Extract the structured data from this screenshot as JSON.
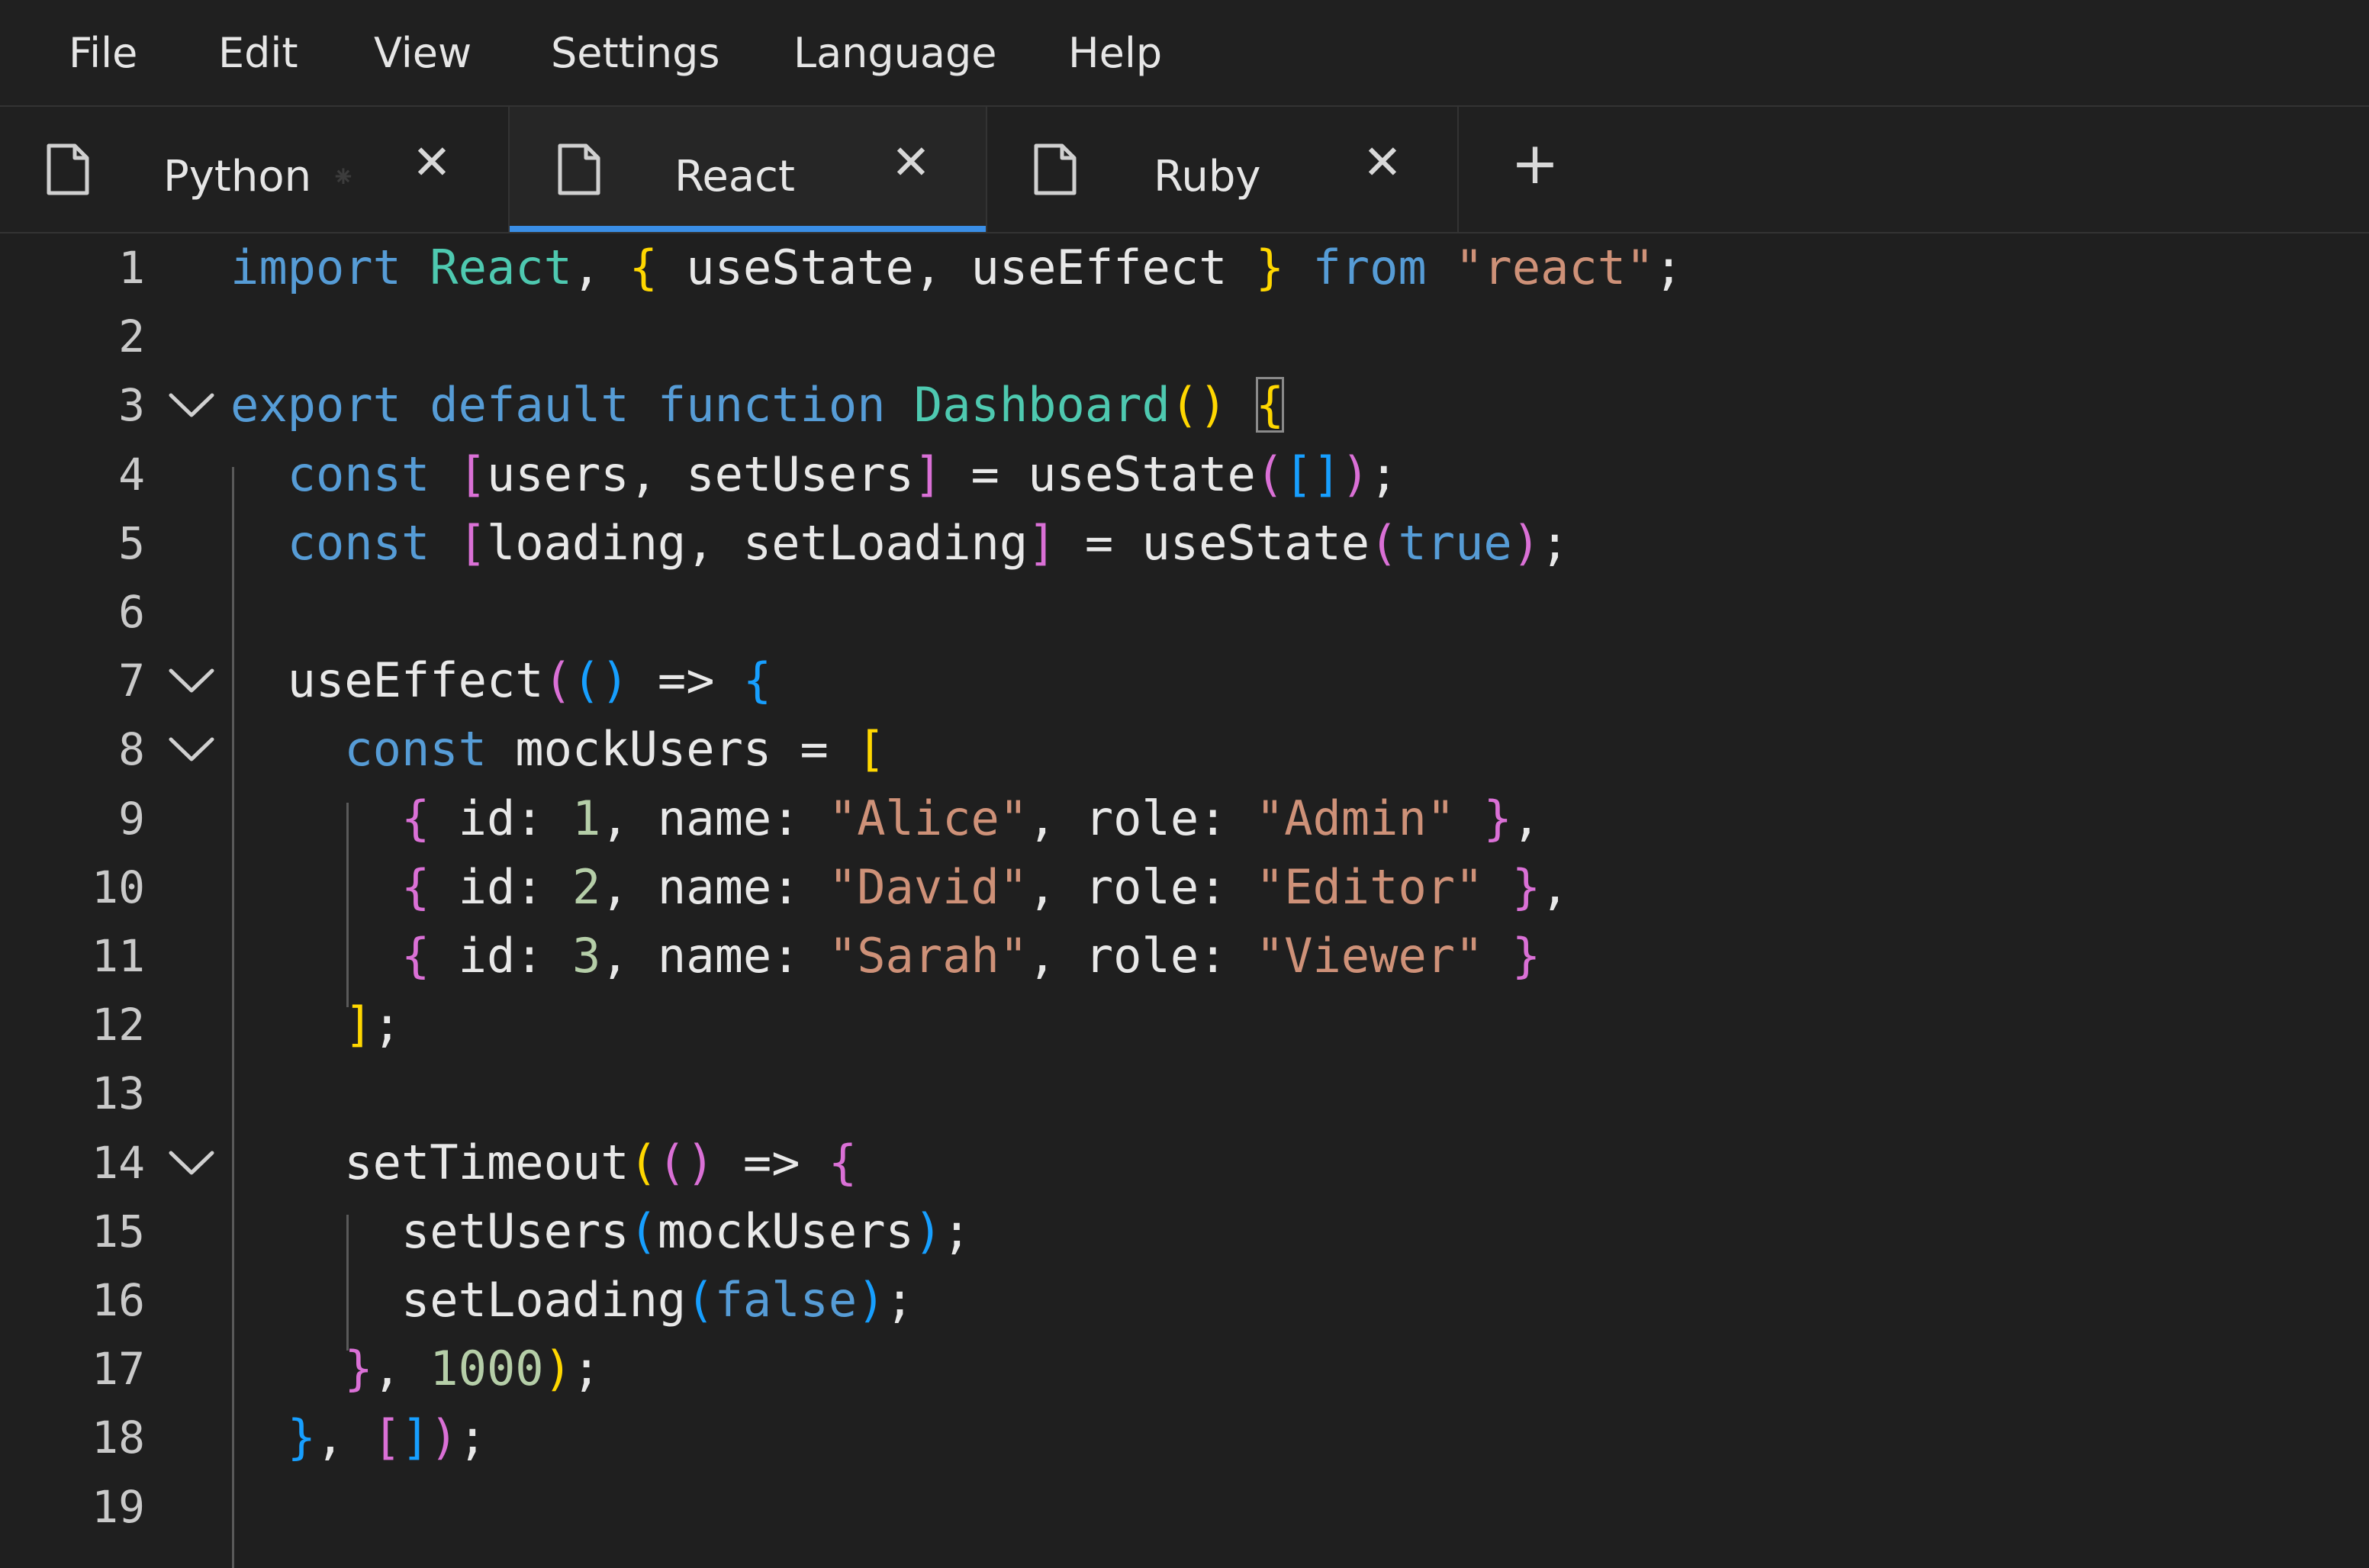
{
  "menu": {
    "items": [
      "File",
      "Edit",
      "View",
      "Settings",
      "Language",
      "Help"
    ]
  },
  "tabs": [
    {
      "label": "Python",
      "icon": "file-icon",
      "active": false,
      "dirty_marker": "⁕"
    },
    {
      "label": "React",
      "icon": "file-icon",
      "active": true
    },
    {
      "label": "Ruby",
      "icon": "file-icon",
      "active": false
    }
  ],
  "tab_close_glyph": "✕",
  "new_tab_glyph": "+",
  "colors": {
    "keyword": "#569cd6",
    "type": "#4ec9b0",
    "string": "#ce9178",
    "number": "#b5cea8",
    "bracket_level1": "#ffd700",
    "bracket_level2": "#da70d6",
    "bracket_level3": "#179fff",
    "active_tab_indicator": "#3a8ee6"
  },
  "editor": {
    "language": "React",
    "lines": [
      {
        "n": "1",
        "fold": false,
        "tokens": [
          [
            "kw",
            "import"
          ],
          [
            "",
            "␠"
          ],
          [
            "ty",
            "React"
          ],
          [
            "",
            ", "
          ],
          [
            "b1",
            "{"
          ],
          [
            "",
            " useState, useEffect "
          ],
          [
            "b1",
            "}"
          ],
          [
            "",
            " "
          ],
          [
            "kw",
            "from"
          ],
          [
            "",
            " "
          ],
          [
            "str",
            "\"react\""
          ],
          [
            "",
            ";"
          ]
        ]
      },
      {
        "n": "2",
        "fold": false,
        "tokens": []
      },
      {
        "n": "3",
        "fold": true,
        "tokens": [
          [
            "kw",
            "export"
          ],
          [
            "",
            " "
          ],
          [
            "kw",
            "default"
          ],
          [
            "",
            " "
          ],
          [
            "kw",
            "function"
          ],
          [
            "",
            " "
          ],
          [
            "ty",
            "Dashboard"
          ],
          [
            "b1",
            "()"
          ],
          [
            "",
            " "
          ],
          [
            "b1m",
            "{"
          ]
        ]
      },
      {
        "n": "4",
        "fold": false,
        "tokens": [
          [
            "",
            "  "
          ],
          [
            "kw",
            "const"
          ],
          [
            "",
            " "
          ],
          [
            "b2",
            "["
          ],
          [
            "",
            "users, setUsers"
          ],
          [
            "b2",
            "]"
          ],
          [
            "",
            " = useState"
          ],
          [
            "b2",
            "("
          ],
          [
            "b3",
            "[]"
          ],
          [
            "b2",
            ")"
          ],
          [
            "",
            ";"
          ]
        ]
      },
      {
        "n": "5",
        "fold": false,
        "tokens": [
          [
            "",
            "  "
          ],
          [
            "kw",
            "const"
          ],
          [
            "",
            " "
          ],
          [
            "b2",
            "["
          ],
          [
            "",
            "loading, setLoading"
          ],
          [
            "b2",
            "]"
          ],
          [
            "",
            " = useState"
          ],
          [
            "b2",
            "("
          ],
          [
            "kw",
            "true"
          ],
          [
            "b2",
            ")"
          ],
          [
            "",
            ";"
          ]
        ]
      },
      {
        "n": "6",
        "fold": false,
        "tokens": []
      },
      {
        "n": "7",
        "fold": true,
        "tokens": [
          [
            "",
            "  useEffect"
          ],
          [
            "b2",
            "("
          ],
          [
            "b3",
            "()"
          ],
          [
            "",
            " => "
          ],
          [
            "b3",
            "{"
          ]
        ]
      },
      {
        "n": "8",
        "fold": true,
        "tokens": [
          [
            "",
            "    "
          ],
          [
            "kw",
            "const"
          ],
          [
            "",
            " mockUsers = "
          ],
          [
            "b1",
            "["
          ]
        ]
      },
      {
        "n": "9",
        "fold": false,
        "tokens": [
          [
            "",
            "      "
          ],
          [
            "b2",
            "{"
          ],
          [
            "",
            " id: "
          ],
          [
            "num",
            "1"
          ],
          [
            "",
            ", name: "
          ],
          [
            "str",
            "\"Alice\""
          ],
          [
            "",
            ", role: "
          ],
          [
            "str",
            "\"Admin\""
          ],
          [
            "",
            " "
          ],
          [
            "b2",
            "}"
          ],
          [
            "",
            ","
          ]
        ]
      },
      {
        "n": "10",
        "fold": false,
        "tokens": [
          [
            "",
            "      "
          ],
          [
            "b2",
            "{"
          ],
          [
            "",
            " id: "
          ],
          [
            "num",
            "2"
          ],
          [
            "",
            ", name: "
          ],
          [
            "str",
            "\"David\""
          ],
          [
            "",
            ", role: "
          ],
          [
            "str",
            "\"Editor\""
          ],
          [
            "",
            " "
          ],
          [
            "b2",
            "}"
          ],
          [
            "",
            ","
          ]
        ]
      },
      {
        "n": "11",
        "fold": false,
        "tokens": [
          [
            "",
            "      "
          ],
          [
            "b2",
            "{"
          ],
          [
            "",
            " id: "
          ],
          [
            "num",
            "3"
          ],
          [
            "",
            ", name: "
          ],
          [
            "str",
            "\"Sarah\""
          ],
          [
            "",
            ", role: "
          ],
          [
            "str",
            "\"Viewer\""
          ],
          [
            "",
            " "
          ],
          [
            "b2",
            "}"
          ]
        ]
      },
      {
        "n": "12",
        "fold": false,
        "tokens": [
          [
            "",
            "    "
          ],
          [
            "b1",
            "]"
          ],
          [
            "",
            ";"
          ]
        ]
      },
      {
        "n": "13",
        "fold": false,
        "tokens": []
      },
      {
        "n": "14",
        "fold": true,
        "tokens": [
          [
            "",
            "    setTimeout"
          ],
          [
            "b1",
            "("
          ],
          [
            "b2",
            "()"
          ],
          [
            "",
            " => "
          ],
          [
            "b2",
            "{"
          ]
        ]
      },
      {
        "n": "15",
        "fold": false,
        "tokens": [
          [
            "",
            "      setUsers"
          ],
          [
            "b3",
            "("
          ],
          [
            "",
            "mockUsers"
          ],
          [
            "b3",
            ")"
          ],
          [
            "",
            ";"
          ]
        ]
      },
      {
        "n": "16",
        "fold": false,
        "tokens": [
          [
            "",
            "      setLoading"
          ],
          [
            "b3",
            "("
          ],
          [
            "kw",
            "false"
          ],
          [
            "b3",
            ")"
          ],
          [
            "",
            ";"
          ]
        ]
      },
      {
        "n": "17",
        "fold": false,
        "tokens": [
          [
            "",
            "    "
          ],
          [
            "b2",
            "}"
          ],
          [
            "",
            ", "
          ],
          [
            "num",
            "1000"
          ],
          [
            "b1",
            ")"
          ],
          [
            "",
            ";"
          ]
        ]
      },
      {
        "n": "18",
        "fold": false,
        "tokens": [
          [
            "",
            "  "
          ],
          [
            "b3",
            "}"
          ],
          [
            "",
            ", "
          ],
          [
            "b2",
            "["
          ],
          [
            "b3",
            "]"
          ],
          [
            "b2",
            ")"
          ],
          [
            "",
            ";"
          ]
        ]
      },
      {
        "n": "19",
        "fold": false,
        "tokens": []
      }
    ]
  }
}
